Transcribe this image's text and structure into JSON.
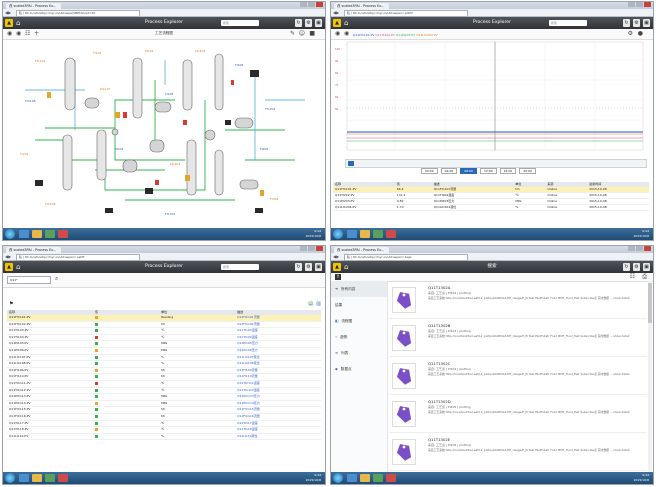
{
  "browser": {
    "tab_label": "改 scaled3PAI - Process Ex...",
    "url_q1": "私 | 80 localhost/pc/myrun/ubf.aspx/SBPTAG/pt=20",
    "url_q2": "私 | 80 localhost/pc/myrun/ubf.aspx/rc.sdhtf",
    "url_q3": "私 | 80 localhost/pc/myrun/ubf.aspx/rc.ashft",
    "url_q4": "私 | 80 localhost/pc/myrun/ubf.aspx/rc.tags"
  },
  "app": {
    "title": "Process Explorer",
    "title_q4": "搜索",
    "search_placeholder": "搜索"
  },
  "toolbar": {
    "pfd_title": "工艺流程图"
  },
  "pfd": {
    "tags": [
      "FIC101",
      "TI102",
      "PI103",
      "LIC104",
      "FI105",
      "TIC106",
      "PIC107",
      "LI108",
      "FIC201",
      "TI202",
      "PI203",
      "LIC204",
      "FI205",
      "TIC206",
      "FIC301",
      "TI302"
    ]
  },
  "trend": {
    "legend_items": [
      "Q11FIC101.PV",
      "Q11TI202.PV",
      "Q11PI203.PV",
      "Q11LIC204.PV"
    ],
    "time_labels": [
      "00:00",
      "04:00",
      "08:00",
      "12:00",
      "16:00",
      "20:00"
    ]
  },
  "trend_table": {
    "headers": [
      "名称",
      "值",
      "描述",
      "单位",
      "来源",
      "最新时间"
    ],
    "rows": [
      [
        "Q11FIC101.PV",
        "66.4",
        "Q11FIC101流量",
        "t/h",
        "Online",
        "2015-10-08"
      ],
      [
        "Q11TI202.PV",
        "131.2",
        "Q11TI202温度",
        "℃",
        "Online",
        "2015-10-08"
      ],
      [
        "Q11PI203.PV",
        "0.82",
        "Q11PI203压力",
        "MPa",
        "Online",
        "2015-10-08"
      ],
      [
        "Q11LIC204.PV",
        "1.70",
        "Q11LIC204液位",
        "%",
        "Online",
        "2015-10-08"
      ]
    ]
  },
  "list": {
    "search_value": "Q11*",
    "headers": [
      "名称",
      "值",
      "单位",
      "描述"
    ],
    "rows": [
      [
        "Q11FIC101.PV",
        "",
        "Reading",
        "Q11FIC101流量"
      ],
      [
        "Q11FIC102.PV",
        "",
        "t/h",
        "Q11FIC102流量"
      ],
      [
        "Q11TI103.PV",
        "",
        "℃",
        "Q11TI103温度"
      ],
      [
        "Q11TI104.PV",
        "",
        "℃",
        "Q11TI104温度"
      ],
      [
        "Q11PI105.PV",
        "",
        "MPa",
        "Q11PI105压力"
      ],
      [
        "Q11PI106.PV",
        "",
        "MPa",
        "Q11PI106压力"
      ],
      [
        "Q11LIC107.PV",
        "",
        "%",
        "Q11LIC107液位"
      ],
      [
        "Q11LIC108.PV",
        "",
        "%",
        "Q11LIC108液位"
      ],
      [
        "Q11FI109.PV",
        "",
        "t/h",
        "Q11FI109流量"
      ],
      [
        "Q11FI110.PV",
        "",
        "t/h",
        "Q11FI110流量"
      ],
      [
        "Q11TIC111.PV",
        "",
        "℃",
        "Q11TIC111温度"
      ],
      [
        "Q11TIC112.PV",
        "",
        "℃",
        "Q11TIC112温度"
      ],
      [
        "Q11PIC113.PV",
        "",
        "MPa",
        "Q11PIC113压力"
      ],
      [
        "Q11PIC114.PV",
        "",
        "MPa",
        "Q11PIC114压力"
      ],
      [
        "Q11FIC115.PV",
        "",
        "t/h",
        "Q11FIC115流量"
      ],
      [
        "Q11FIC116.PV",
        "",
        "t/h",
        "Q11FIC116流量"
      ],
      [
        "Q11TI117.PV",
        "",
        "℃",
        "Q11TI117温度"
      ],
      [
        "Q11TI118.PV",
        "",
        "℃",
        "Q11TI118温度"
      ],
      [
        "Q11LI119.PV",
        "",
        "%",
        "Q11LI119液位"
      ]
    ]
  },
  "search_page": {
    "sidebar": [
      {
        "label": "所有内容",
        "icon": "arrow-icon"
      },
      {
        "label": "结果",
        "icon": ""
      },
      {
        "label": "流程图",
        "icon": "chart-icon"
      },
      {
        "label": "趋势",
        "icon": "trend-icon"
      },
      {
        "label": "列表",
        "icon": "list-icon"
      },
      {
        "label": "数据点",
        "icon": "tag-icon"
      }
    ],
    "results": [
      {
        "name": "Q11T1302A",
        "sub": "来自: 工艺点 | PI102 | plotting",
        "desc": "来自工艺系统 http://localhost/SvrLeaf/L2_plot/pilotAtPlot/LMT_Usage/P_PI Test PilotFutatr Fluid MMT_Fluid_Test Subscribe点 实时数据 ... show detail"
      },
      {
        "name": "Q11T1302B",
        "sub": "来自: 工艺点 | PI103 | plotting",
        "desc": "来自工艺系统 http://localhost/SvrLeaf/L2_plot/pilotAtPlot/LMT_Usage/P_PI Test PilotFutatr Fluid MMT_Fluid_Test Subscribe点 实时数据 ... show detail"
      },
      {
        "name": "Q11T1302C",
        "sub": "来自: 工艺点 | PI104 | plotting",
        "desc": "来自工艺系统 http://localhost/SvrLeaf/L2_plot/pilotAtPlot/LMT_Usage/P_PI Test PilotFutatr Fluid MMT_Fluid_Test Subscribe点 实时数据 ... show detail"
      },
      {
        "name": "Q11T1302D",
        "sub": "来自: 工艺点 | PI105 | plotting",
        "desc": "来自工艺系统 http://localhost/SvrLeaf/L2_plot/pilotAtPlot/LMT_Usage/P_PI Test PilotFutatr Fluid MMT_Fluid_Test Subscribe点 实时数据 ... show detail"
      },
      {
        "name": "Q11T1302E",
        "sub": "来自: 工艺点 | PI106 | plotting",
        "desc": "来自工艺系统 http://localhost/SvrLeaf/L2_plot/pilotAtPlot/LMT_Usage/P_PI Test PilotFutatr Fluid MMT_Fluid_Test Subscribe点 实时数据 ... show detail"
      }
    ]
  },
  "taskbar": {
    "time": "9:44",
    "date": "2015/10/8"
  },
  "colors": {
    "appbar": "#3a3d41",
    "logo": "#f2c400",
    "selected_row": "#fdf2b5",
    "tag_purple": "#7a4fc7",
    "pipe_green": "#2fb54a",
    "trend_blue": "#2a4fd0"
  }
}
